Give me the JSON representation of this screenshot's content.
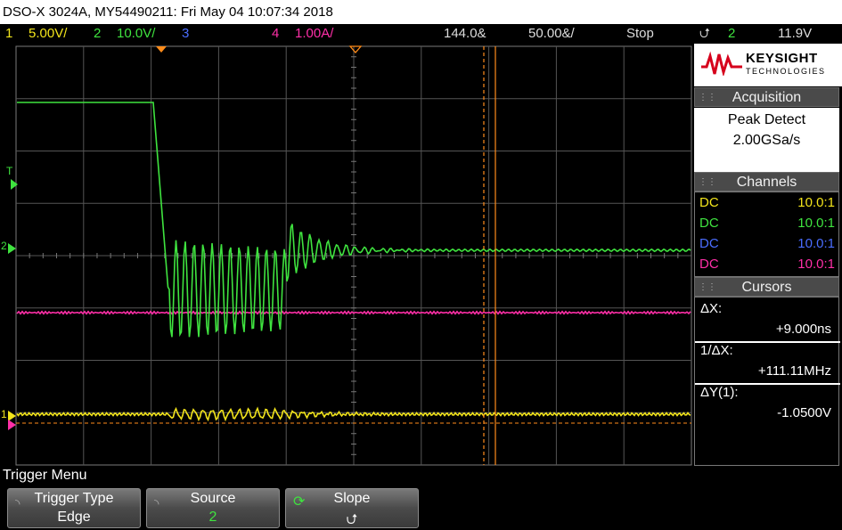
{
  "title_bar": {
    "text": "DSO-X 3024A, MY54490211: Fri May 04 10:07:34 2018"
  },
  "status_bar": {
    "ch1": {
      "num": "1",
      "scale": "5.00V/"
    },
    "ch2": {
      "num": "2",
      "scale": "10.0V/"
    },
    "ch3": {
      "num": "3",
      "scale": ""
    },
    "ch4": {
      "num": "4",
      "scale": "1.00A/"
    },
    "delay": "144.0&",
    "timebase": "50.00&/",
    "run_state": "Stop",
    "trigger_slope_glyph": "⮍",
    "trigger_source": "2",
    "trigger_level": "11.9V"
  },
  "brand": {
    "name": "KEYSIGHT",
    "sub": "TECHNOLOGIES"
  },
  "acquisition": {
    "header": "Acquisition",
    "mode": "Peak Detect",
    "rate": "2.00GSa/s"
  },
  "channels": {
    "header": "Channels",
    "rows": [
      {
        "coupling": "DC",
        "probe": "10.0:1",
        "color": "#f2e41b"
      },
      {
        "coupling": "DC",
        "probe": "10.0:1",
        "color": "#3fe33f"
      },
      {
        "coupling": "DC",
        "probe": "10.0:1",
        "color": "#4a6dff"
      },
      {
        "coupling": "DC",
        "probe": "10.0:1",
        "color": "#ff2fa8"
      }
    ]
  },
  "cursors": {
    "header": "Cursors",
    "dx_label": "ΔX:",
    "dx_value": "+9.000ns",
    "inv_label": "1/ΔX:",
    "inv_value": "+111.11MHz",
    "dy_label": "ΔY(1):",
    "dy_value": "-1.0500V"
  },
  "trigger_menu": {
    "title": "Trigger Menu",
    "softkeys": [
      {
        "label": "Trigger Type",
        "value": "Edge",
        "icon": "rotary-knob-icon"
      },
      {
        "label": "Source",
        "value": "2",
        "icon": "rotary-knob-icon"
      },
      {
        "label": "Slope",
        "value": "⮍",
        "icon": "rotate-arrow-icon"
      }
    ]
  },
  "markers": {
    "trigger_label": "T",
    "ch2_label": "2",
    "ch1_label": "1"
  },
  "colors": {
    "ch1": "#f2e41b",
    "ch2": "#3fe33f",
    "ch3": "#4a6dff",
    "ch4": "#ff2fa8",
    "cursor": "#ff8c1a"
  }
}
